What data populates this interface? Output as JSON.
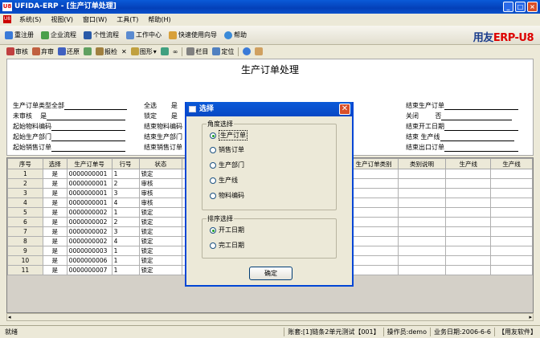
{
  "window": {
    "title": "UFIDA-ERP  - [生产订单处理]",
    "app_badge": "U8"
  },
  "menu": {
    "items": [
      "系统(S)",
      "视图(V)",
      "窗口(W)",
      "工具(T)",
      "帮助(H)"
    ]
  },
  "toolbar1": {
    "items": [
      "重注册",
      "企业流程",
      "个性流程",
      "工作中心",
      "快速使用向导",
      "帮助"
    ],
    "brand_left": "用友",
    "brand_right": "ERP-U8"
  },
  "toolbar2": {
    "items": [
      "审核",
      "弃审",
      "还原",
      "",
      "报检",
      "",
      "图形",
      "",
      "",
      "栏目",
      "定位",
      "",
      ""
    ]
  },
  "page": {
    "title": "生产订单处理"
  },
  "filters": {
    "col1": [
      {
        "label": "生产订单类型",
        "value": "全部"
      },
      {
        "label": "未审核",
        "value": "是"
      },
      {
        "label": "起始物料编码",
        "value": ""
      },
      {
        "label": "起始生产部门",
        "value": ""
      },
      {
        "label": "起始销售订单",
        "value": ""
      }
    ],
    "col2": [
      {
        "label": "全选",
        "value": "是"
      },
      {
        "label": "锁定",
        "value": "是"
      },
      {
        "label": "结束物料编码",
        "value": ""
      },
      {
        "label": "结束生产部门",
        "value": ""
      },
      {
        "label": "结束销售订单",
        "value": ""
      }
    ],
    "col4": [
      {
        "label": "结束生产订单",
        "value": ""
      },
      {
        "label": "关闭",
        "value": "否"
      },
      {
        "label": "结束开工日期",
        "value": ""
      },
      {
        "label": "结束  生产线",
        "value": ""
      },
      {
        "label": "结束出口订单",
        "value": ""
      }
    ]
  },
  "grid": {
    "headers": [
      "序号",
      "选择",
      "生产订单号",
      "行号",
      "状态"
    ],
    "right_headers": [
      "生产订单类别",
      "类别说明",
      "生产线",
      "生产线"
    ],
    "rows": [
      [
        "1",
        "是",
        "0000000001",
        "1",
        "锁定"
      ],
      [
        "2",
        "是",
        "0000000001",
        "2",
        "审核"
      ],
      [
        "3",
        "是",
        "0000000001",
        "3",
        "审核"
      ],
      [
        "4",
        "是",
        "0000000001",
        "4",
        "审核"
      ],
      [
        "5",
        "是",
        "0000000002",
        "1",
        "锁定"
      ],
      [
        "6",
        "是",
        "0000000002",
        "2",
        "锁定"
      ],
      [
        "7",
        "是",
        "0000000002",
        "3",
        "锁定"
      ],
      [
        "8",
        "是",
        "0000000002",
        "4",
        "锁定"
      ],
      [
        "9",
        "是",
        "0000000003",
        "1",
        "锁定"
      ],
      [
        "10",
        "是",
        "0000000006",
        "1",
        "锁定"
      ],
      [
        "11",
        "是",
        "0000000007",
        "1",
        "锁定"
      ]
    ]
  },
  "dialog": {
    "title": "选择",
    "angle_group": "角度选择",
    "angle_options": [
      "生产订单",
      "销售订单",
      "生产部门",
      "生产线",
      "物料编码"
    ],
    "sort_group": "排序选择",
    "sort_options": [
      "开工日期",
      "完工日期"
    ],
    "ok": "确定"
  },
  "status": {
    "ready": "就绪",
    "account": "账套:[1]链条2单元测试【001】",
    "operator": "操作员:demo",
    "date": "业务日期:2006-6-6",
    "company": "【用友软件】"
  }
}
